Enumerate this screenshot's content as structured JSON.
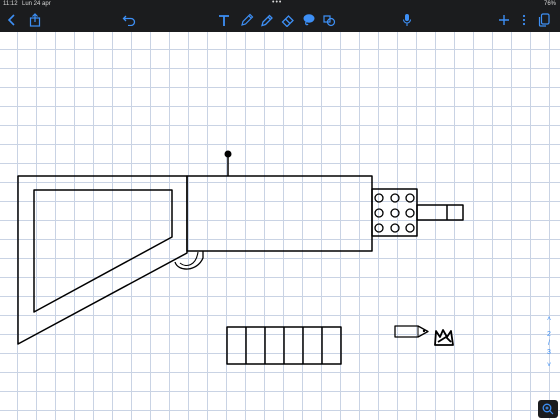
{
  "status": {
    "time": "11:12",
    "date": "Lun 24 apr",
    "dots": "•••",
    "battery": "76%"
  },
  "toolbar": {
    "items": [
      "back-icon",
      "share-icon",
      "undo-icon",
      "text-tool-icon",
      "pen-tool-icon",
      "highlighter-tool-icon",
      "eraser-tool-icon",
      "lasso-tool-icon",
      "shapes-tool-icon",
      "microphone-icon",
      "add-icon",
      "more-icon",
      "pages-icon"
    ],
    "accent": "#3d8ff5"
  },
  "pager": {
    "up": "˄",
    "current": "2",
    "sep": "/",
    "total": "3",
    "down": "˅"
  },
  "colors": {
    "grid": "#c9d3e4",
    "bar": "#1b1c1e",
    "ink": "#000000"
  }
}
